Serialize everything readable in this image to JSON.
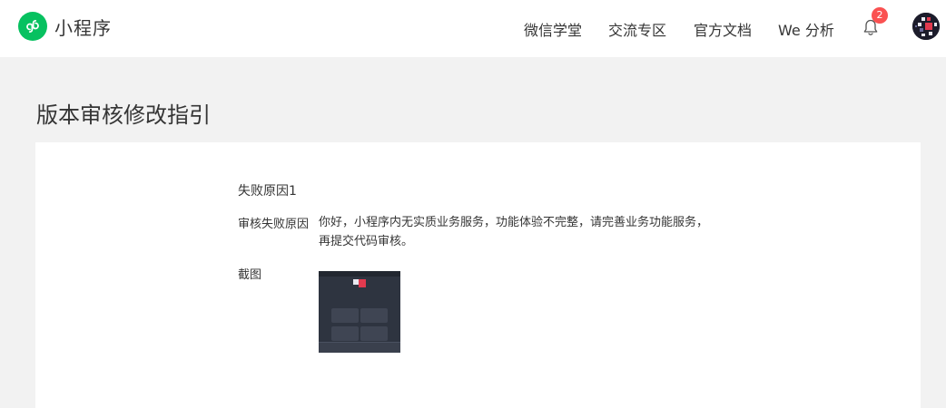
{
  "header": {
    "app_name": "小程序",
    "nav": [
      "微信学堂",
      "交流专区",
      "官方文档",
      "We 分析"
    ],
    "notification_count": "2"
  },
  "page": {
    "title": "版本审核修改指引"
  },
  "failure": {
    "section_title": "失败原因1",
    "reason_label": "审核失败原因",
    "reason_text": "你好，小程序内无实质业务服务，功能体验不完整，请完善业务功能服务，再提交代码审核。",
    "screenshot_label": "截图"
  },
  "colors": {
    "brand": "#07c160",
    "badge": "#fa5151",
    "background": "#f2f2f2"
  }
}
